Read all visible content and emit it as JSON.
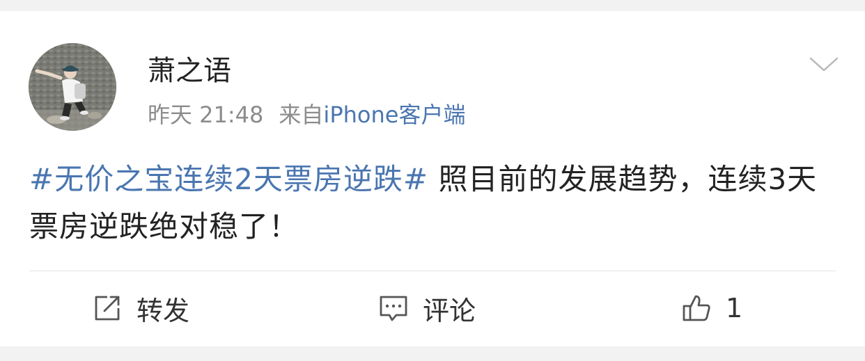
{
  "post": {
    "username": "萧之语",
    "time": "昨天 21:48",
    "source_prefix": "来自",
    "source": "iPhone客户端",
    "topic": "#无价之宝连续2天票房逆跌#",
    "text": " 照目前的发展趋势，连续3天票房逆跌绝对稳了！"
  },
  "actions": {
    "repost_label": "转发",
    "comment_label": "评论",
    "like_count": "1"
  },
  "icons": {
    "avatar": "user-avatar-photo",
    "menu": "chevron-down-icon",
    "repost": "share-square-arrow-icon",
    "comment": "comment-bubble-icon",
    "like": "thumbs-up-icon"
  },
  "colors": {
    "link": "#4a76b0",
    "text": "#222222",
    "meta": "#8c8c8c",
    "background": "#f2f2f2"
  }
}
